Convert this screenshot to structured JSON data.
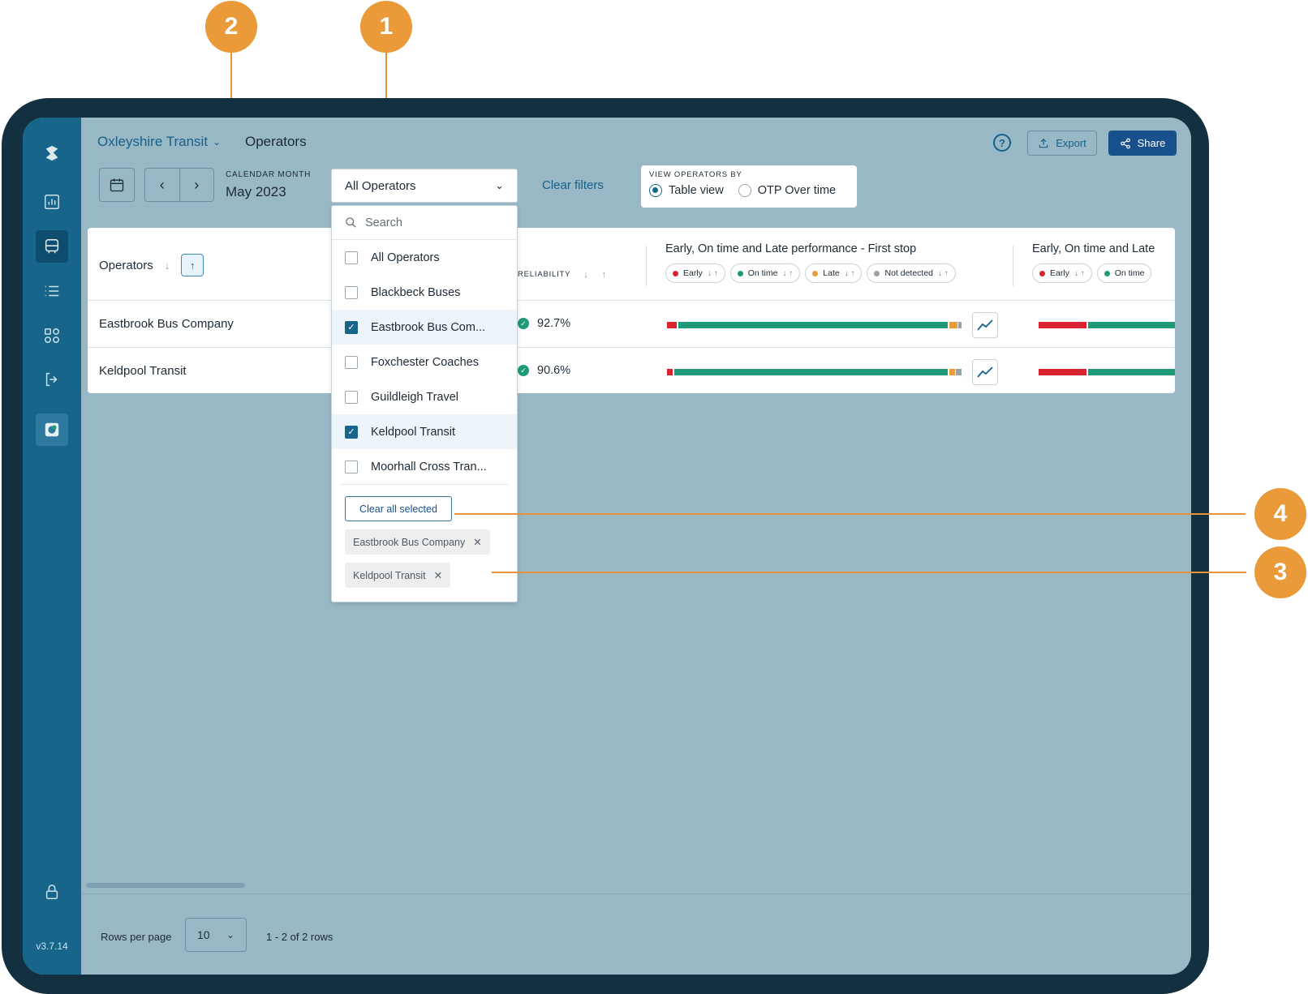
{
  "sidebar": {
    "version": "v3.7.14"
  },
  "header": {
    "org": "Oxleyshire Transit",
    "title": "Operators",
    "help": "?",
    "export_label": "Export",
    "share_label": "Share"
  },
  "toolbar": {
    "calendar_label": "CALENDAR MONTH",
    "calendar_value": "May 2023",
    "operator_select": "All Operators",
    "clear_filters": "Clear filters",
    "view_label": "VIEW OPERATORS BY",
    "view_options": [
      "Table view",
      "OTP Over time"
    ],
    "view_selected": "Table view"
  },
  "table": {
    "col_operators": "Operators",
    "col_reliability": "RELIABILITY",
    "col_perf_first": "Early, On time and Late performance - First stop",
    "col_perf_second": "Early, On time and Late",
    "chips": [
      {
        "label": "Early",
        "color": "#d9232e"
      },
      {
        "label": "On time",
        "color": "#1f9a78"
      },
      {
        "label": "Late",
        "color": "#ea9a39"
      },
      {
        "label": "Not detected",
        "color": "#9aa0a6"
      }
    ],
    "chips_second": [
      {
        "label": "Early",
        "color": "#d9232e"
      },
      {
        "label": "On time",
        "color": "#1f9a78"
      }
    ],
    "rows": [
      {
        "name": "Eastbrook Bus Company",
        "reliability": "92.7%"
      },
      {
        "name": "Keldpool Transit",
        "reliability": "90.6%"
      }
    ]
  },
  "dropdown": {
    "search_placeholder": "Search",
    "items": [
      {
        "label": "All Operators",
        "checked": false
      },
      {
        "label": "Blackbeck Buses",
        "checked": false
      },
      {
        "label": "Eastbrook Bus Com...",
        "checked": true
      },
      {
        "label": "Foxchester Coaches",
        "checked": false
      },
      {
        "label": "Guildleigh Travel",
        "checked": false
      },
      {
        "label": "Keldpool Transit",
        "checked": true
      },
      {
        "label": "Moorhall Cross Tran...",
        "checked": false
      }
    ],
    "clear_all": "Clear all selected",
    "tags": [
      "Eastbrook Bus Company",
      "Keldpool Transit"
    ]
  },
  "footer": {
    "rows_per_page_label": "Rows per page",
    "rows_per_page_value": "10",
    "range": "1 - 2 of 2 rows"
  },
  "callouts": [
    "1",
    "2",
    "3",
    "4"
  ],
  "colors": {
    "early": "#d9232e",
    "on_time": "#1f9a78",
    "late": "#ea9a39",
    "not_detected": "#9aa0a6",
    "callout": "#ea9a39",
    "brand": "#17658a"
  }
}
